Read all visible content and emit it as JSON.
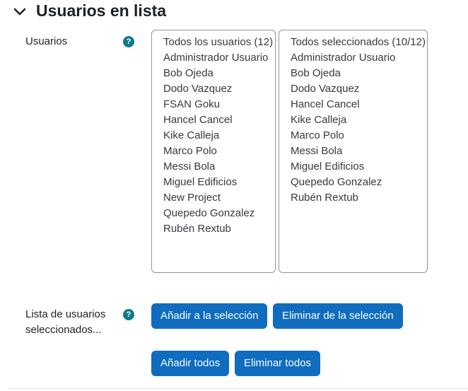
{
  "section": {
    "title": "Usuarios en lista"
  },
  "users_field": {
    "label": "Usuarios",
    "help_icon": "question-circle-icon",
    "available": {
      "header": "Todos los usuarios (12)",
      "items": [
        "Administrador Usuario",
        "Bob Ojeda",
        "Dodo Vazquez",
        "FSAN Goku",
        "Hancel Cancel",
        "Kike Calleja",
        "Marco Polo",
        "Messi Bola",
        "Miguel Edificios",
        "New Project",
        "Quepedo Gonzalez",
        "Rubén Rextub"
      ]
    },
    "selected": {
      "header": "Todos seleccionados (10/12)",
      "items": [
        "Administrador Usuario",
        "Bob Ojeda",
        "Dodo Vazquez",
        "Hancel Cancel",
        "Kike Calleja",
        "Marco Polo",
        "Messi Bola",
        "Miguel Edificios",
        "Quepedo Gonzalez",
        "Rubén Rextub"
      ]
    }
  },
  "selected_list_field": {
    "label_line1": "Lista de usuarios",
    "label_line2": "seleccionados...",
    "help_icon": "question-circle-icon"
  },
  "buttons": {
    "add_selection": "Añadir a la selección",
    "remove_selection": "Eliminar de la selección",
    "add_all": "Añadir todos",
    "remove_all": "Eliminar todos"
  },
  "colors": {
    "primary": "#0f6cbf",
    "help": "#0d7a8c"
  }
}
